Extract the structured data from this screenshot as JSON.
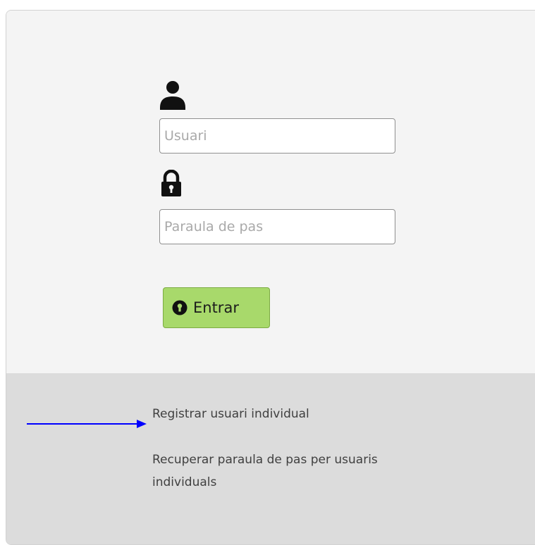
{
  "login_form": {
    "username_placeholder": "Usuari",
    "password_placeholder": "Paraula de pas",
    "submit_label": "Entrar",
    "user_icon": "user-icon",
    "lock_icon": "lock-icon",
    "submit_icon": "keyhole-icon"
  },
  "footer": {
    "register_link": "Registrar usuari individual",
    "recover_link": "Recuperar paraula de pas per usuaris individuals"
  },
  "annotation": {
    "arrow_color": "#0000ff",
    "arrow_icon": "right-arrow"
  },
  "colors": {
    "submit_button": "#a8d96b",
    "panel_background": "#f4f4f4",
    "footer_background": "#dcdcdc"
  }
}
